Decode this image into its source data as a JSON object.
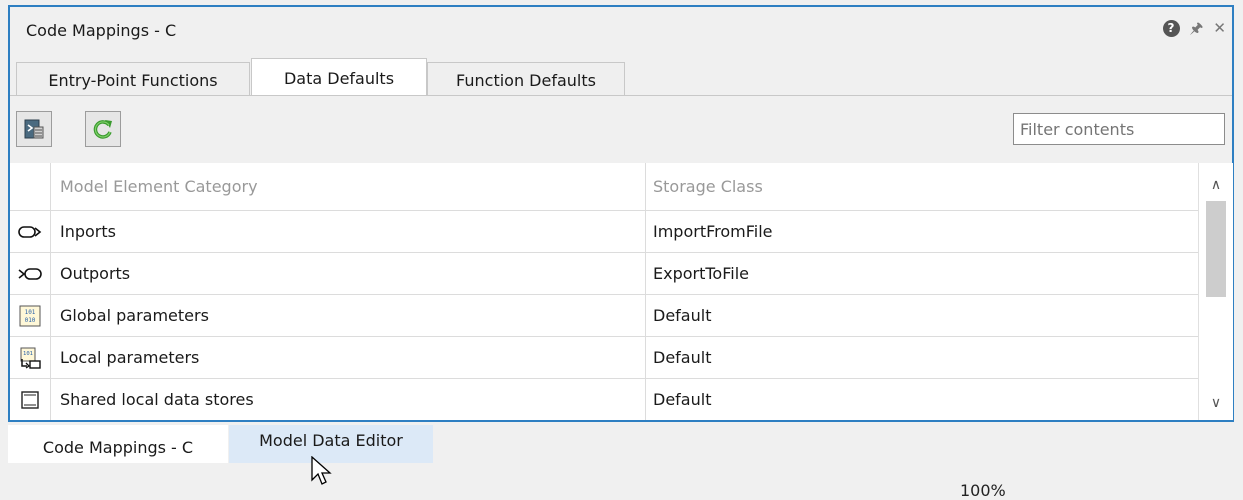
{
  "panel": {
    "title": "Code Mappings - C",
    "icons": {
      "help": "help-icon",
      "pin": "pin-icon",
      "close": "close-icon"
    }
  },
  "tabs": [
    {
      "label": "Entry-Point Functions",
      "active": false
    },
    {
      "label": "Data Defaults",
      "active": true
    },
    {
      "label": "Function Defaults",
      "active": false
    }
  ],
  "toolbar": {
    "buttons": [
      "configure-icon",
      "refresh-icon"
    ],
    "filter_placeholder": "Filter contents"
  },
  "table": {
    "headers": {
      "category": "Model Element Category",
      "storage": "Storage Class"
    },
    "rows": [
      {
        "icon": "inport-icon",
        "category": "Inports",
        "storage": "ImportFromFile"
      },
      {
        "icon": "outport-icon",
        "category": "Outports",
        "storage": "ExportToFile"
      },
      {
        "icon": "global-parameter-icon",
        "category": "Global parameters",
        "storage": "Default"
      },
      {
        "icon": "local-parameter-icon",
        "category": "Local parameters",
        "storage": "Default"
      },
      {
        "icon": "data-store-icon",
        "category": "Shared local data stores",
        "storage": "Default"
      }
    ]
  },
  "bottom_tabs": [
    {
      "label": "Code Mappings - C",
      "active": true
    },
    {
      "label": "Model Data Editor",
      "hovered": true
    }
  ],
  "status": {
    "zoom": "100%"
  },
  "colors": {
    "accent": "#2e7fc2",
    "hover_tab": "#dce9f7"
  }
}
